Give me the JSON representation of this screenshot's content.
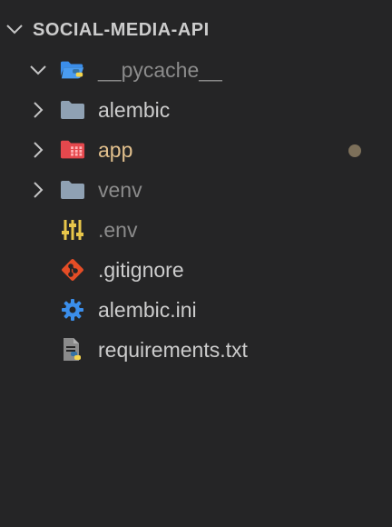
{
  "explorer": {
    "title": "SOCIAL-MEDIA-API",
    "items": [
      {
        "label": "__pycache__",
        "icon": "python-folder-open-icon",
        "state": "expanded"
      },
      {
        "label": "alembic",
        "icon": "folder-icon",
        "state": "collapsed"
      },
      {
        "label": "app",
        "icon": "app-folder-icon",
        "state": "collapsed",
        "modified": true
      },
      {
        "label": "venv",
        "icon": "folder-icon",
        "state": "collapsed"
      },
      {
        "label": ".env",
        "icon": "env-settings-icon"
      },
      {
        "label": ".gitignore",
        "icon": "git-icon"
      },
      {
        "label": "alembic.ini",
        "icon": "gear-icon"
      },
      {
        "label": "requirements.txt",
        "icon": "python-file-icon"
      }
    ]
  },
  "colors": {
    "background": "#252526",
    "text": "#cccccc",
    "dimmed_text": "#8b8b8b",
    "modified_text": "#e2c08d",
    "modified_dot": "#7d705a",
    "folder": "#8fa1b3",
    "python_blue": "#3b8eea",
    "app_red": "#f14c4c",
    "env_yellow": "#e8c64a",
    "git_orange": "#e44d26"
  }
}
